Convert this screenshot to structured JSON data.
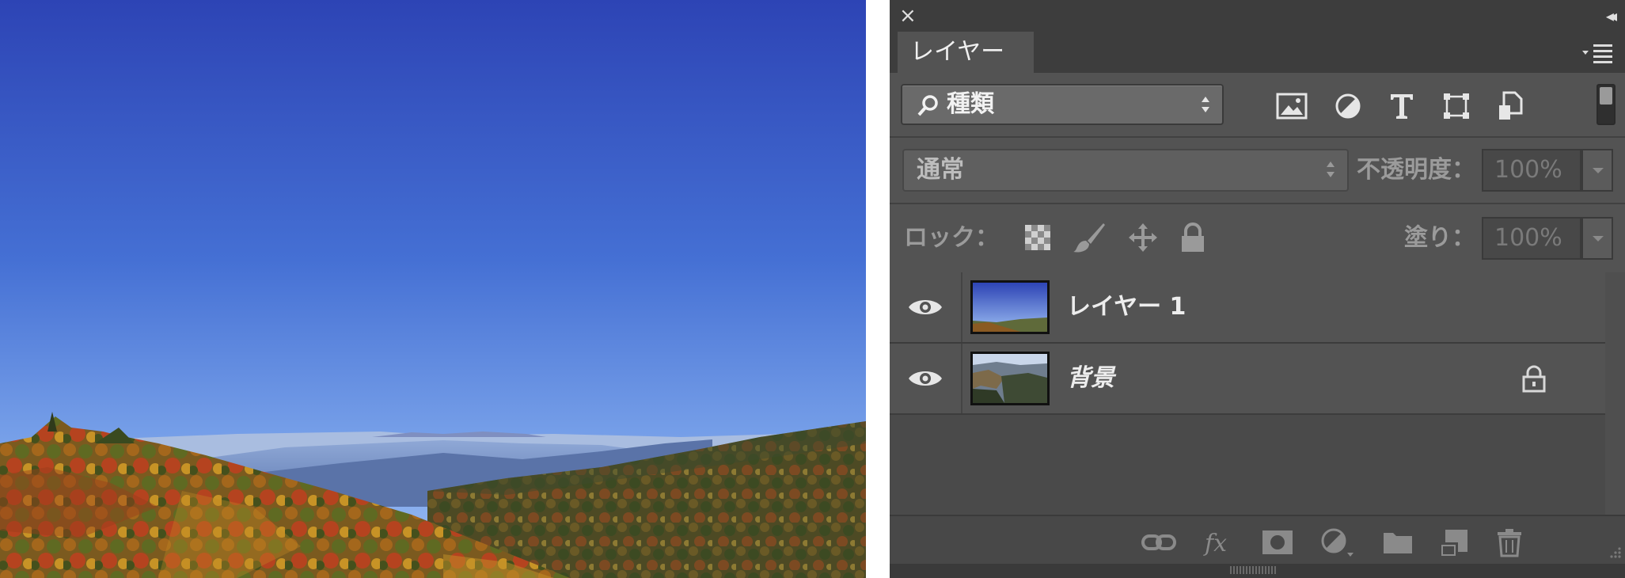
{
  "canvas": {
    "image": "autumn-mountain-landscape"
  },
  "panel": {
    "close_glyph": "×",
    "collapse_glyph": "◂◂",
    "tab_label": "レイヤー",
    "filter": {
      "kind_label": "種類",
      "icons": [
        "image-filter-icon",
        "adjustment-filter-icon",
        "type-filter-icon",
        "shape-filter-icon",
        "smart-object-filter-icon"
      ]
    },
    "blend": {
      "mode": "通常",
      "opacity_label": "不透明度：",
      "opacity_value": "100%"
    },
    "lock": {
      "label": "ロック：",
      "icons": [
        "lock-transparent-icon",
        "lock-image-icon",
        "lock-position-icon",
        "lock-all-icon"
      ],
      "fill_label": "塗り：",
      "fill_value": "100%"
    },
    "layers": [
      {
        "name": "レイヤー 1",
        "visible": true,
        "locked": false,
        "italic": false
      },
      {
        "name": "背景",
        "visible": true,
        "locked": true,
        "italic": true
      }
    ],
    "bottom_icons": [
      "link-layers-icon",
      "fx-icon",
      "mask-icon",
      "adjustment-layer-icon",
      "group-folder-icon",
      "new-layer-icon",
      "trash-icon"
    ]
  },
  "colors": {
    "panel_bg": "#535353",
    "sky_top": "#2d44b5",
    "sky_bottom": "#8eb4f0"
  }
}
